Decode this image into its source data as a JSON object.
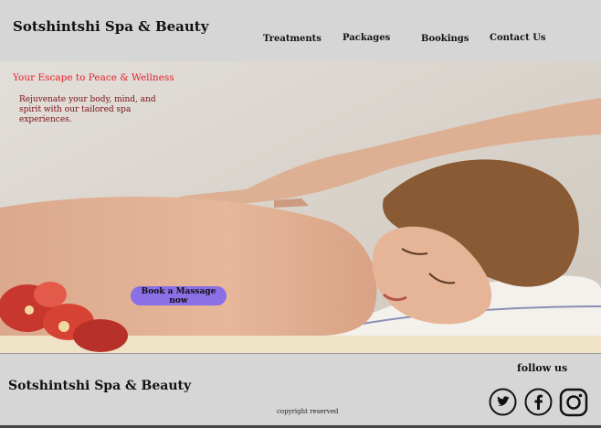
{
  "header": {
    "brand": "Sotshintshi Spa & Beauty",
    "nav": [
      "Treatments",
      "Packages",
      "Bookings",
      "Contact Us"
    ]
  },
  "hero": {
    "title": "Your Escape to Peace & Wellness",
    "subtitle": "Rejuvenate your body, mind, and spirit with our tailored spa experiences.",
    "cta_label": "Book a Massage now"
  },
  "footer": {
    "brand": "Sotshintshi Spa & Beauty",
    "copyright": "copyright reserved",
    "follow_label": "follow us",
    "social": [
      "twitter-icon",
      "facebook-icon",
      "instagram-icon"
    ]
  },
  "colors": {
    "background": "#d6d6d6",
    "hero_title": "#e8212a",
    "hero_subtitle": "#7a1016",
    "cta": "#8a6fe6"
  }
}
